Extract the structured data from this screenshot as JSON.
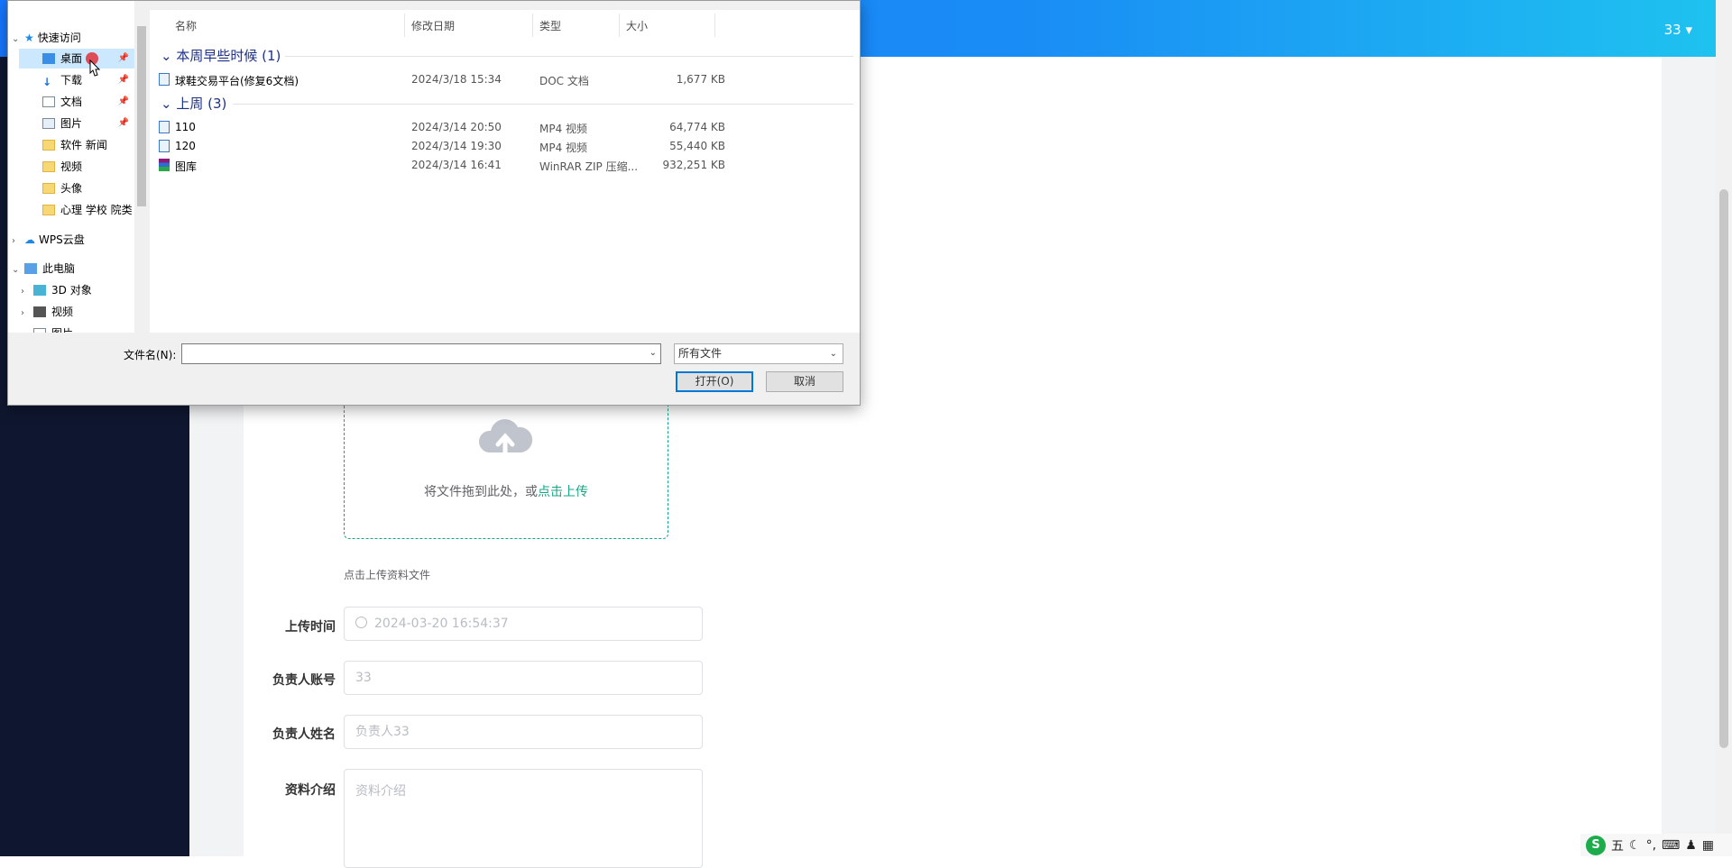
{
  "app": {
    "user_menu": "33 ▾",
    "upload": {
      "text": "将文件拖到此处，或",
      "link": "点击上传",
      "tip": "点击上传资料文件"
    },
    "form": {
      "upload_time": {
        "label": "上传时间",
        "value": "2024-03-20 16:54:37"
      },
      "account": {
        "label": "负责人账号",
        "value": "33"
      },
      "name": {
        "label": "负责人姓名",
        "value": "负责人33"
      },
      "intro": {
        "label": "资料介绍",
        "placeholder": "资料介绍"
      }
    }
  },
  "dialog": {
    "nav": {
      "quick_access": "快速访问",
      "items": [
        "桌面",
        "下载",
        "文档",
        "图片",
        "软件 新闻",
        "视频",
        "头像",
        "心理 学校 院类"
      ],
      "wps": "WPS云盘",
      "this_pc": "此电脑",
      "pc_items": [
        "3D 对象",
        "视频",
        "图片"
      ]
    },
    "columns": {
      "name": "名称",
      "date": "修改日期",
      "type": "类型",
      "size": "大小"
    },
    "groups": [
      {
        "label": "本周早些时候 (1)",
        "files": [
          {
            "name": "球鞋交易平台(修复6文档)",
            "date": "2024/3/18 15:34",
            "type": "DOC 文档",
            "size": "1,677 KB"
          }
        ]
      },
      {
        "label": "上周 (3)",
        "files": [
          {
            "name": "110",
            "date": "2024/3/14 20:50",
            "type": "MP4 视频",
            "size": "64,774 KB"
          },
          {
            "name": "120",
            "date": "2024/3/14 19:30",
            "type": "MP4 视频",
            "size": "55,440 KB"
          },
          {
            "name": "图库",
            "date": "2024/3/14 16:41",
            "type": "WinRAR ZIP 压缩...",
            "size": "932,251 KB"
          }
        ]
      }
    ],
    "filename_label": "文件名(N):",
    "filename_value": "",
    "filetype": "所有文件",
    "open_button": "打开(O)",
    "cancel_button": "取消"
  },
  "tray": {
    "ime": "五",
    "logo": "S"
  }
}
